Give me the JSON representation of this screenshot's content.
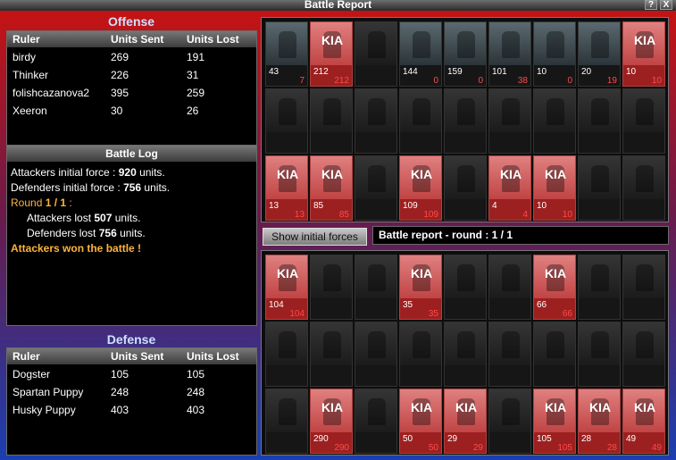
{
  "window": {
    "title": "Battle Report",
    "help_label": "?",
    "close_label": "X"
  },
  "offense": {
    "title": "Offense",
    "columns": [
      "Ruler",
      "Units Sent",
      "Units Lost"
    ],
    "rows": [
      [
        "birdy",
        "269",
        "191"
      ],
      [
        "Thinker",
        "226",
        "31"
      ],
      [
        "folishcazanova2",
        "395",
        "259"
      ],
      [
        "Xeeron",
        "30",
        "26"
      ]
    ]
  },
  "battle_log": {
    "title": "Battle Log",
    "line1_pre": "Attackers initial force : ",
    "line1_val": "920",
    "line1_post": " units.",
    "line2_pre": "Defenders initial force : ",
    "line2_val": "756",
    "line2_post": " units.",
    "round_label": "Round ",
    "round_val": "1 / 1",
    "round_post": " :",
    "line4_pre": "Attackers lost ",
    "line4_val": "507",
    "line4_post": " units.",
    "line5_pre": "Defenders lost ",
    "line5_val": "756",
    "line5_post": " units.",
    "result": "Attackers won the battle !"
  },
  "defense": {
    "title": "Defense",
    "columns": [
      "Ruler",
      "Units Sent",
      "Units Lost"
    ],
    "rows": [
      [
        "Dogster",
        "105",
        "105"
      ],
      [
        "Spartan Puppy",
        "248",
        "248"
      ],
      [
        "Husky Puppy",
        "403",
        "403"
      ]
    ]
  },
  "show_button": "Show initial forces",
  "round_title": "Battle report - round : 1 / 1",
  "kia_label": "KIA",
  "attacker_grid": [
    [
      {
        "s": "43",
        "l": "7",
        "k": false
      },
      {
        "s": "212",
        "l": "212",
        "k": true
      },
      {
        "s": "",
        "l": "",
        "k": false
      },
      {
        "s": "144",
        "l": "0",
        "k": false
      },
      {
        "s": "159",
        "l": "0",
        "k": false
      },
      {
        "s": "101",
        "l": "38",
        "k": false
      },
      {
        "s": "10",
        "l": "0",
        "k": false
      },
      {
        "s": "20",
        "l": "19",
        "k": false
      },
      {
        "s": "10",
        "l": "10",
        "k": true
      }
    ],
    [
      {
        "s": "",
        "l": "",
        "k": false
      },
      {
        "s": "",
        "l": "",
        "k": false
      },
      {
        "s": "",
        "l": "",
        "k": false
      },
      {
        "s": "",
        "l": "",
        "k": false
      },
      {
        "s": "",
        "l": "",
        "k": false
      },
      {
        "s": "",
        "l": "",
        "k": false
      },
      {
        "s": "",
        "l": "",
        "k": false
      },
      {
        "s": "",
        "l": "",
        "k": false
      },
      {
        "s": "",
        "l": "",
        "k": false
      }
    ],
    [
      {
        "s": "13",
        "l": "13",
        "k": true
      },
      {
        "s": "85",
        "l": "85",
        "k": true
      },
      {
        "s": "",
        "l": "",
        "k": false
      },
      {
        "s": "109",
        "l": "109",
        "k": true
      },
      {
        "s": "",
        "l": "",
        "k": false
      },
      {
        "s": "4",
        "l": "4",
        "k": true
      },
      {
        "s": "10",
        "l": "10",
        "k": true
      },
      {
        "s": "",
        "l": "",
        "k": false
      },
      {
        "s": "",
        "l": "",
        "k": false
      }
    ]
  ],
  "defender_grid": [
    [
      {
        "s": "104",
        "l": "104",
        "k": true
      },
      {
        "s": "",
        "l": "",
        "k": false
      },
      {
        "s": "",
        "l": "",
        "k": false
      },
      {
        "s": "35",
        "l": "35",
        "k": true
      },
      {
        "s": "",
        "l": "",
        "k": false
      },
      {
        "s": "",
        "l": "",
        "k": false
      },
      {
        "s": "66",
        "l": "66",
        "k": true
      },
      {
        "s": "",
        "l": "",
        "k": false
      },
      {
        "s": "",
        "l": "",
        "k": false
      }
    ],
    [
      {
        "s": "",
        "l": "",
        "k": false
      },
      {
        "s": "",
        "l": "",
        "k": false
      },
      {
        "s": "",
        "l": "",
        "k": false
      },
      {
        "s": "",
        "l": "",
        "k": false
      },
      {
        "s": "",
        "l": "",
        "k": false
      },
      {
        "s": "",
        "l": "",
        "k": false
      },
      {
        "s": "",
        "l": "",
        "k": false
      },
      {
        "s": "",
        "l": "",
        "k": false
      },
      {
        "s": "",
        "l": "",
        "k": false
      }
    ],
    [
      {
        "s": "",
        "l": "",
        "k": false
      },
      {
        "s": "290",
        "l": "290",
        "k": true
      },
      {
        "s": "",
        "l": "",
        "k": false
      },
      {
        "s": "50",
        "l": "50",
        "k": true
      },
      {
        "s": "29",
        "l": "29",
        "k": true
      },
      {
        "s": "",
        "l": "",
        "k": false
      },
      {
        "s": "105",
        "l": "105",
        "k": true
      },
      {
        "s": "28",
        "l": "28",
        "k": true
      },
      {
        "s": "49",
        "l": "49",
        "k": true
      }
    ]
  ]
}
